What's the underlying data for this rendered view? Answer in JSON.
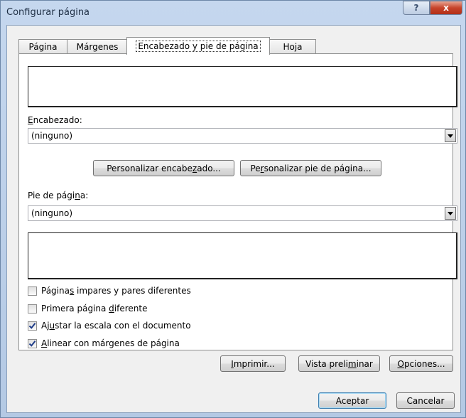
{
  "window": {
    "title": "Configurar página",
    "help_label": "?",
    "close_label": "x"
  },
  "tabs": [
    {
      "label": "Página",
      "active": false
    },
    {
      "label": "Márgenes",
      "active": false
    },
    {
      "label": "Encabezado y pie de página",
      "active": true
    },
    {
      "label": "Hoja",
      "active": false
    }
  ],
  "header": {
    "label_pre": "",
    "label_mn": "E",
    "label_post": "ncabezado:",
    "value": "(ninguno)"
  },
  "custom_header_button": {
    "pre": "Personalizar encabe",
    "mn": "z",
    "post": "ado..."
  },
  "custom_footer_button": {
    "pre": "Pe",
    "mn": "r",
    "post": "sonalizar pie de página..."
  },
  "footer": {
    "label_pre": "Pie de pági",
    "label_mn": "n",
    "label_post": "a:",
    "value": "(ninguno)"
  },
  "options": [
    {
      "pre": "Página",
      "mn": "s",
      "post": " impares y pares diferentes",
      "checked": false
    },
    {
      "pre": "Primera página ",
      "mn": "d",
      "post": "iferente",
      "checked": false
    },
    {
      "pre": "Aj",
      "mn": "u",
      "post": "star la escala con el documento",
      "checked": true
    },
    {
      "pre": "",
      "mn": "A",
      "post": "linear con márgenes de página",
      "checked": true
    }
  ],
  "print_button": {
    "pre": "",
    "mn": "I",
    "post": "mprimir..."
  },
  "preview_button": {
    "pre": "Vista preli",
    "mn": "m",
    "post": "inar"
  },
  "options_button": {
    "pre": "",
    "mn": "O",
    "post": "pciones..."
  },
  "ok_button": {
    "label": "Aceptar"
  },
  "cancel_button": {
    "label": "Cancelar"
  }
}
